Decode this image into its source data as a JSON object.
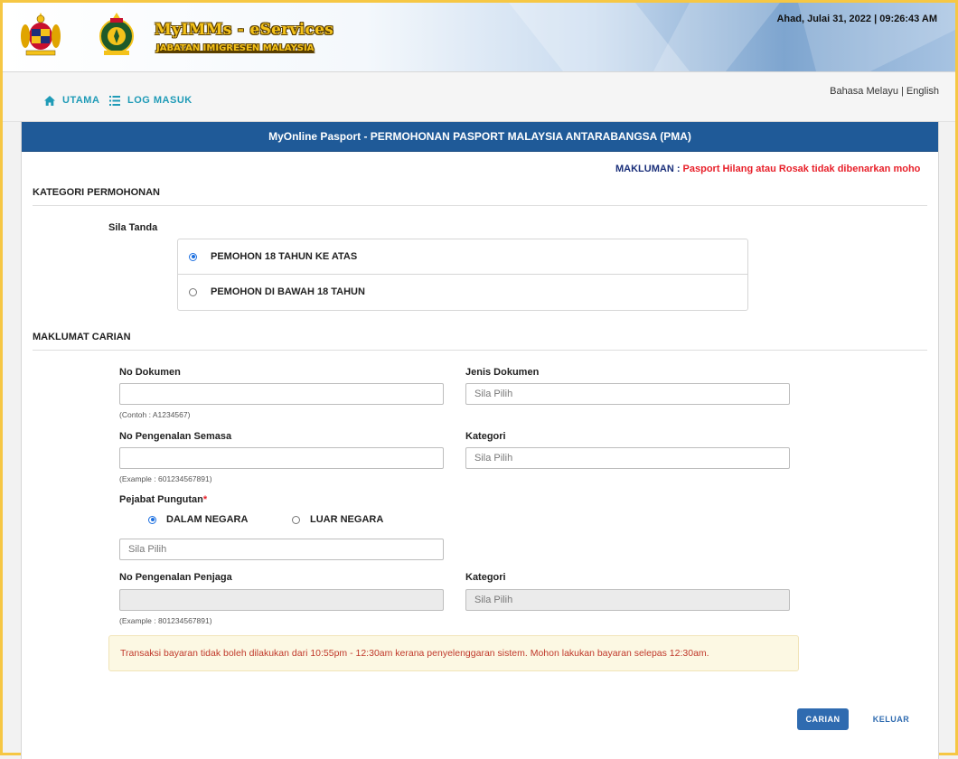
{
  "header": {
    "brand_title": "MyIMMs - eServices",
    "brand_subtitle": "JABATAN IMIGRESEN MALAYSIA",
    "datetime": "Ahad, Julai 31, 2022 | 09:26:43 AM"
  },
  "nav": {
    "home_label": "UTAMA",
    "login_label": "LOG MASUK",
    "lang_malay": "Bahasa Melayu",
    "lang_separator": "|",
    "lang_english": "English"
  },
  "panel": {
    "title": "MyOnline Pasport - PERMOHONAN PASPORT MALAYSIA ANTARABANGSA (PMA)",
    "notice_label": "MAKLUMAN :",
    "notice_text": "Pasport Hilang atau Rosak tidak dibenarkan moho"
  },
  "kategori": {
    "section_title": "KATEGORI PERMOHONAN",
    "prompt": "Sila Tanda",
    "options": [
      {
        "label": "PEMOHON 18 TAHUN KE ATAS",
        "selected": true
      },
      {
        "label": "PEMOHON DI BAWAH 18 TAHUN",
        "selected": false
      }
    ]
  },
  "carian": {
    "section_title": "MAKLUMAT CARIAN",
    "no_dokumen": {
      "label": "No Dokumen",
      "value": "",
      "hint": "(Contoh : A1234567)"
    },
    "jenis_dokumen": {
      "label": "Jenis Dokumen",
      "value": "Sila Pilih"
    },
    "no_pengenalan": {
      "label": "No Pengenalan Semasa",
      "value": "",
      "hint": "(Example : 601234567891)"
    },
    "kategori_1": {
      "label": "Kategori",
      "value": "Sila Pilih"
    },
    "pejabat": {
      "label": "Pejabat Pungutan",
      "required_mark": "*",
      "options": [
        {
          "label": "DALAM NEGARA",
          "selected": true
        },
        {
          "label": "LUAR NEGARA",
          "selected": false
        }
      ],
      "value": "Sila Pilih"
    },
    "no_penjaga": {
      "label": "No Pengenalan Penjaga",
      "value": "",
      "hint": "(Example : 801234567891)"
    },
    "kategori_2": {
      "label": "Kategori",
      "value": "Sila Pilih"
    }
  },
  "alert": {
    "text": "Transaksi bayaran tidak boleh dilakukan dari 10:55pm - 12:30am kerana penyelenggaran sistem. Mohon lakukan bayaran selepas 12:30am."
  },
  "actions": {
    "search_label": "CARIAN",
    "exit_label": "KELUAR"
  },
  "colors": {
    "header_blue": "#1f5a98",
    "nav_teal": "#1f9bb7",
    "notice_red": "#e8202a",
    "border_gold": "#f6c744"
  },
  "icons": {
    "home": "home-icon",
    "login": "list-icon"
  }
}
